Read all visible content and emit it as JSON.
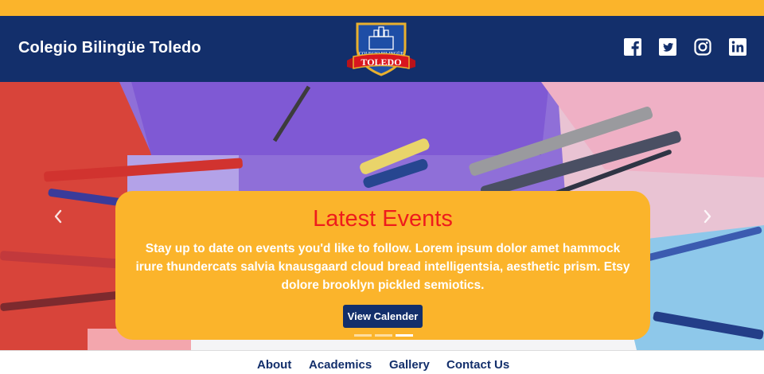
{
  "header": {
    "site_title": "Colegio Bilingüe Toledo",
    "logo": {
      "top_text": "COLEGIO BILINGÜE",
      "banner_text": "TOLEDO",
      "icon": "school-crest-icon"
    },
    "social": [
      {
        "name": "facebook-icon"
      },
      {
        "name": "twitter-icon"
      },
      {
        "name": "instagram-icon"
      },
      {
        "name": "linkedin-icon"
      }
    ]
  },
  "hero": {
    "title": "Latest Events",
    "text": "Stay up to date on events you'd like to follow. Lorem ipsum dolor amet hammock irure thundercats salvia knausgaard cloud bread intelligentsia, aesthetic prism. Etsy dolore brooklyn pickled semiotics.",
    "button_label": "View Calender",
    "slides": 3,
    "active_slide": 3,
    "prev_icon": "chevron-left-icon",
    "next_icon": "chevron-right-icon"
  },
  "nav": {
    "items": [
      "About",
      "Academics",
      "Gallery",
      "Contact Us"
    ]
  },
  "colors": {
    "accent_yellow": "#fbb42b",
    "navy": "#132f6b",
    "title_red": "#ee1c1c"
  }
}
